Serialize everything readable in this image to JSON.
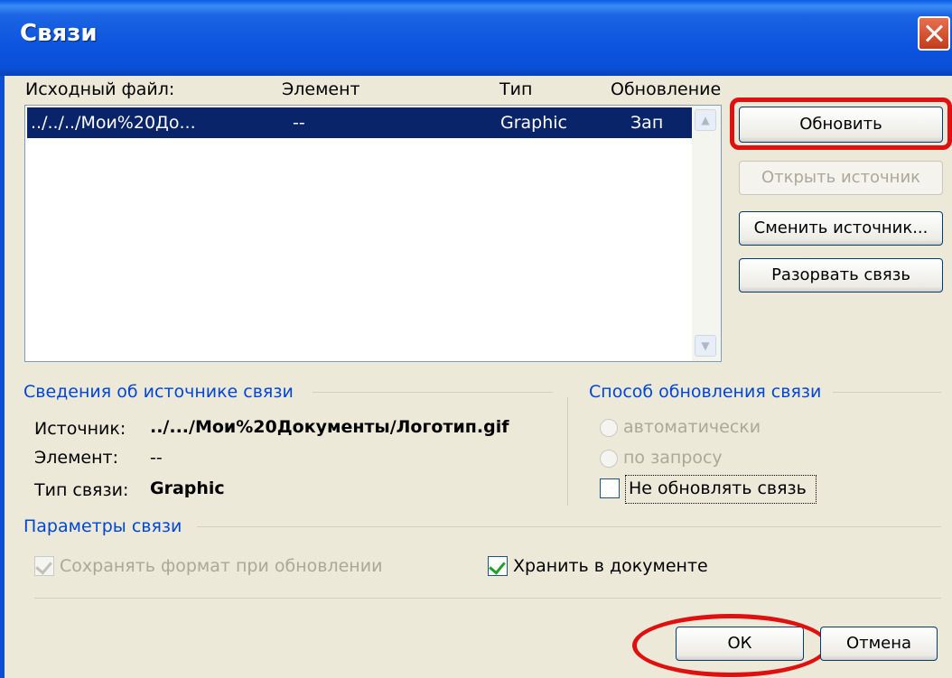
{
  "window": {
    "title": "Связи"
  },
  "list": {
    "headers": {
      "source": "Исходный файл:",
      "element": "Элемент",
      "type": "Тип",
      "update": "Обновление"
    },
    "rows": [
      {
        "source": "../../../Мои%20До...",
        "element": "--",
        "type": "Graphic",
        "update": "Зап"
      }
    ]
  },
  "buttons": {
    "update_now": "Обновить",
    "open_source": "Открыть источник",
    "change_source": "Сменить источник...",
    "break_link": "Разорвать связь",
    "ok": "ОК",
    "cancel": "Отмена"
  },
  "source_info": {
    "title": "Сведения об источнике связи",
    "source_label": "Источник:",
    "source_value": "../.../Мои%20Документы/Логотип.gif",
    "element_label": "Элемент:",
    "element_value": "--",
    "type_label": "Тип связи:",
    "type_value": "Graphic"
  },
  "update_method": {
    "title": "Способ обновления связи",
    "auto_label": "автоматически",
    "manual_label": "по запросу",
    "locked_label": "Не обновлять связь",
    "locked_checked": false
  },
  "link_options": {
    "title": "Параметры связи",
    "preserve_format_label": "Сохранять формат при обновлении",
    "preserve_format_checked": true,
    "save_in_doc_label": "Хранить в документе",
    "save_in_doc_checked": true
  },
  "colors": {
    "title_bar": "#0a4fd6",
    "selection": "#0a246a",
    "group_title": "#0046d5",
    "highlight": "#e01010"
  }
}
